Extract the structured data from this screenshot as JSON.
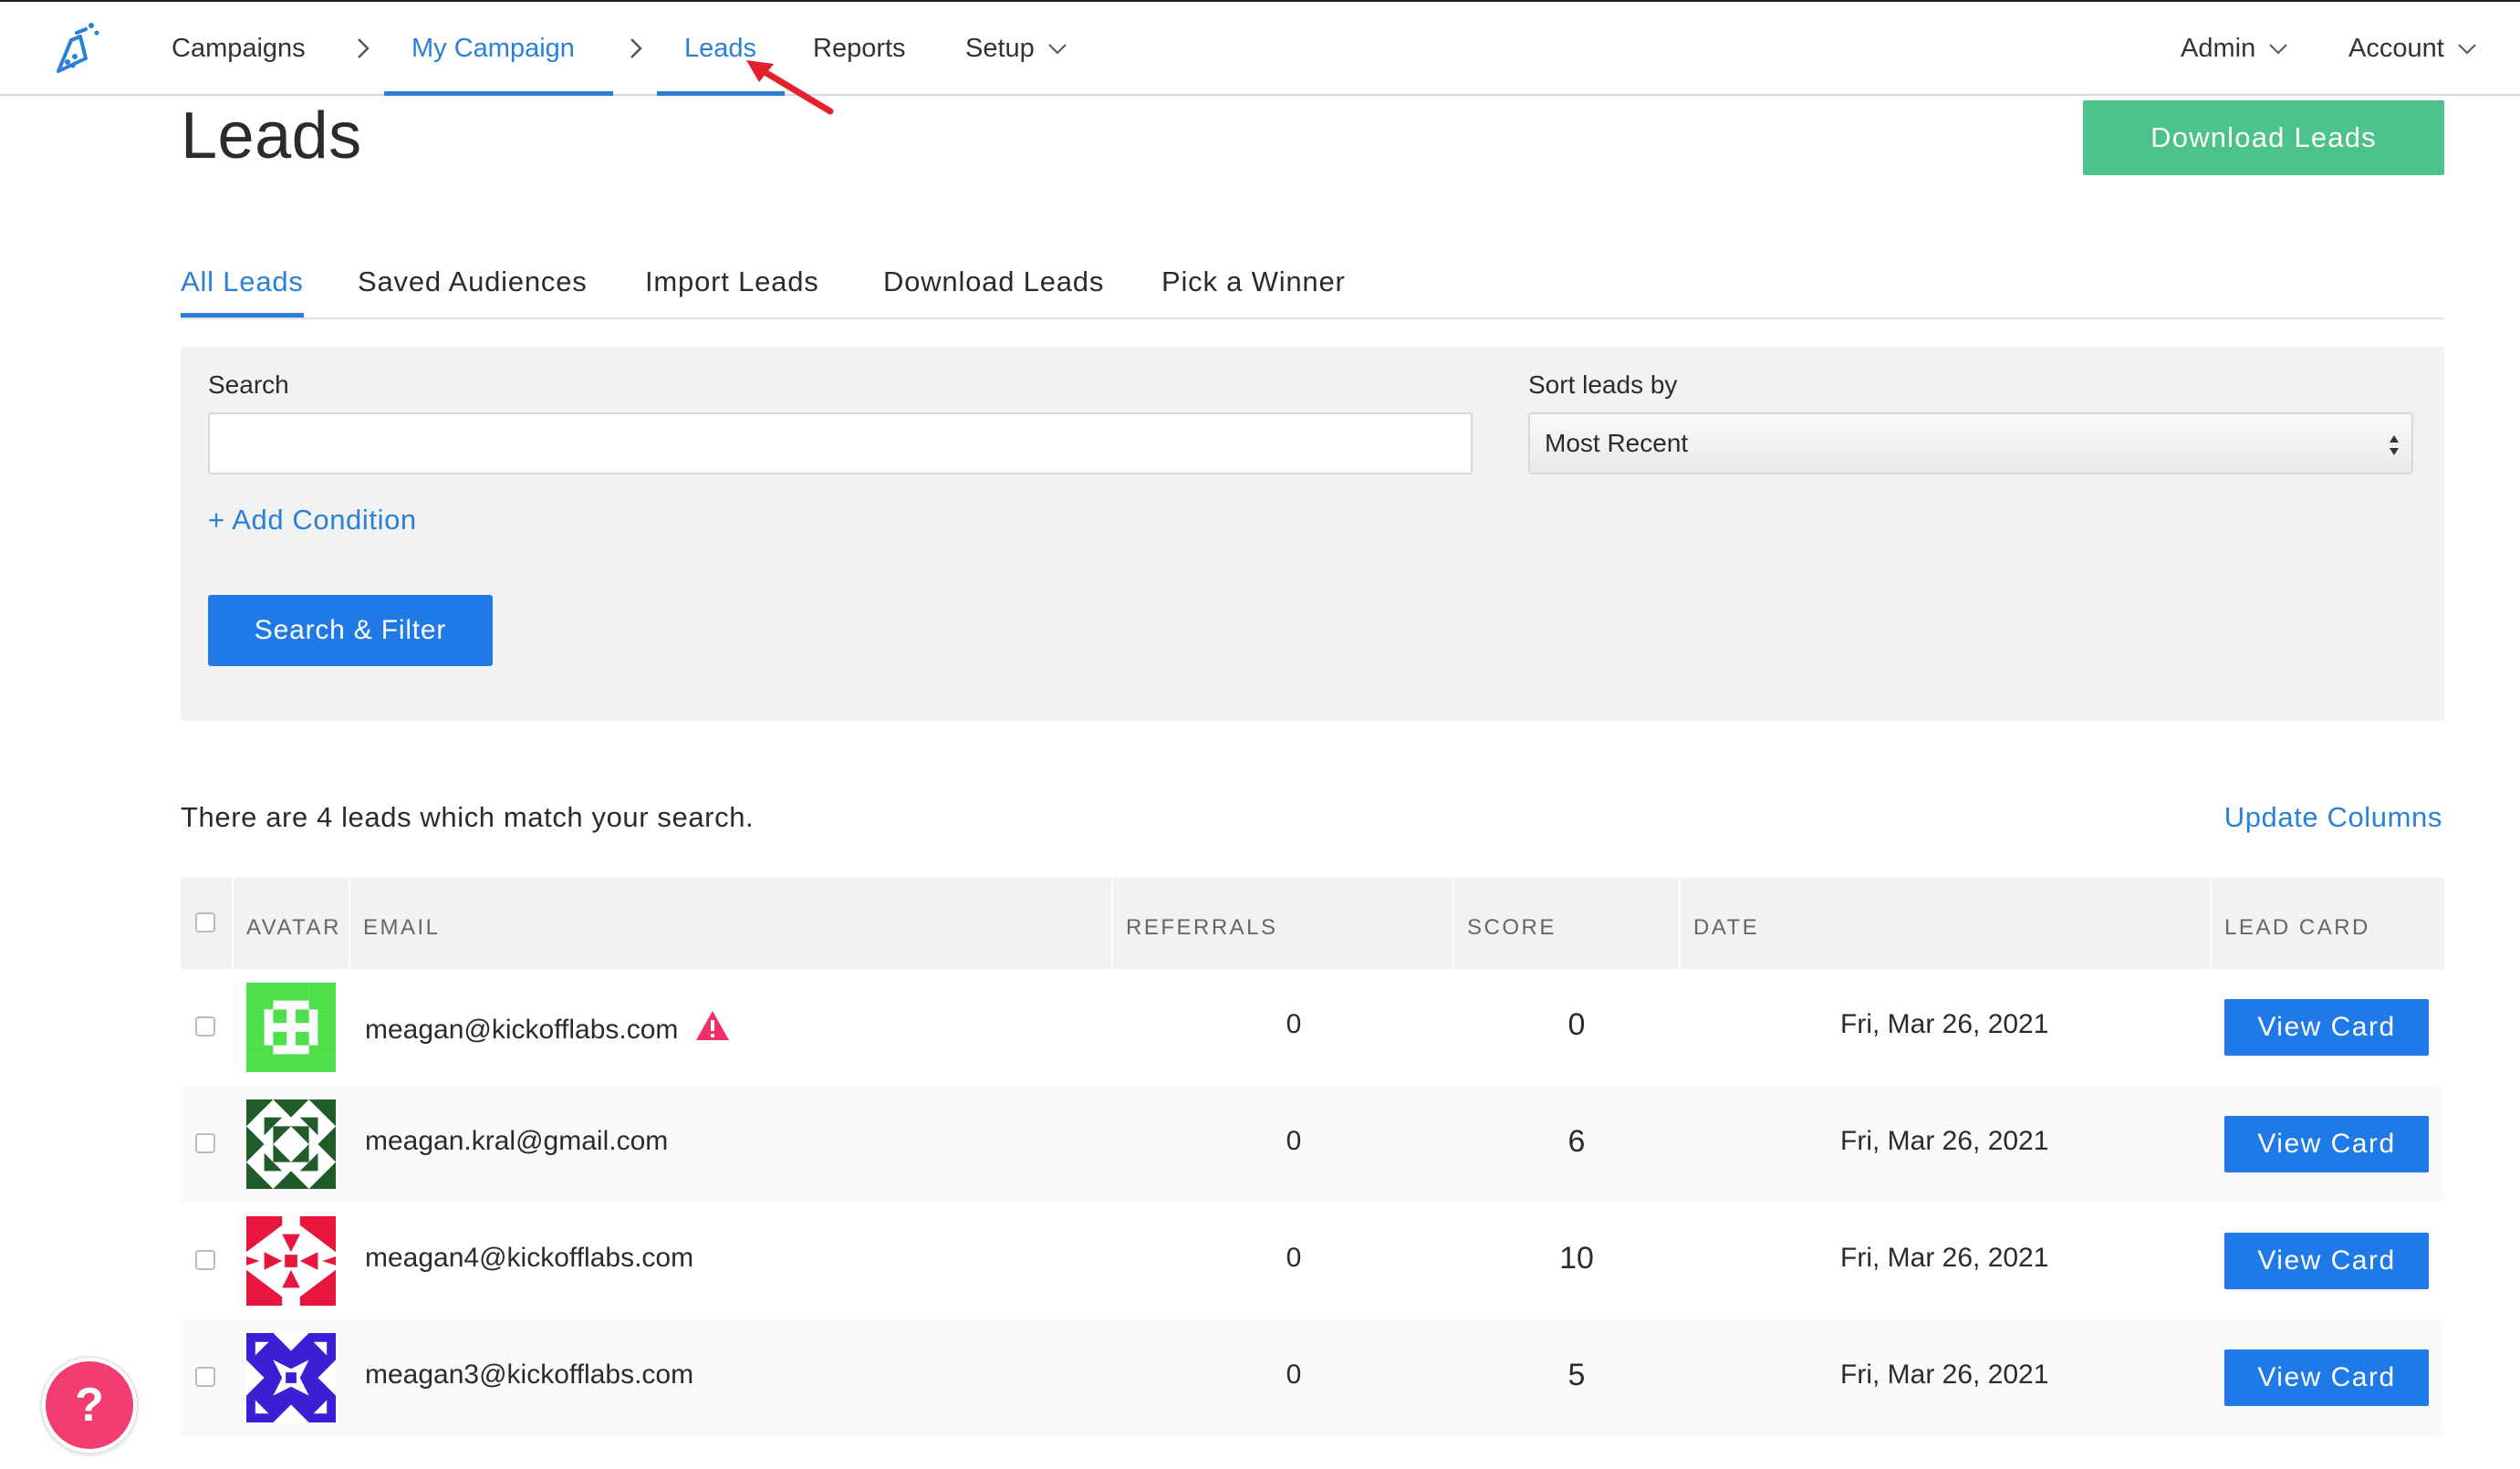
{
  "nav": {
    "breadcrumb": [
      "Campaigns",
      "My Campaign",
      "Leads"
    ],
    "reports": "Reports",
    "setup": "Setup",
    "admin": "Admin",
    "account": "Account"
  },
  "header": {
    "title": "Leads",
    "download_button": "Download Leads"
  },
  "tabs": [
    "All Leads",
    "Saved Audiences",
    "Import Leads",
    "Download Leads",
    "Pick a Winner"
  ],
  "filter": {
    "search_label": "Search",
    "search_value": "",
    "sort_label": "Sort leads by",
    "sort_value": "Most Recent",
    "add_condition": "+ Add Condition",
    "search_button": "Search & Filter"
  },
  "results": {
    "summary": "There are 4 leads which match your search.",
    "update_columns": "Update Columns"
  },
  "table": {
    "headers": [
      "AVATAR",
      "EMAIL",
      "REFERRALS",
      "SCORE",
      "DATE",
      "LEAD CARD"
    ],
    "rows": [
      {
        "email": "meagan@kickofflabs.com",
        "warning": true,
        "referrals": "0",
        "score": "0",
        "date": "Fri, Mar 26, 2021",
        "action": "View Card",
        "avatar_color": "#4ee04a"
      },
      {
        "email": "meagan.kral@gmail.com",
        "warning": false,
        "referrals": "0",
        "score": "6",
        "date": "Fri, Mar 26, 2021",
        "action": "View Card",
        "avatar_color": "#1f5c2a"
      },
      {
        "email": "meagan4@kickofflabs.com",
        "warning": false,
        "referrals": "0",
        "score": "10",
        "date": "Fri, Mar 26, 2021",
        "action": "View Card",
        "avatar_color": "#e8163c"
      },
      {
        "email": "meagan3@kickofflabs.com",
        "warning": false,
        "referrals": "0",
        "score": "5",
        "date": "Fri, Mar 26, 2021",
        "action": "View Card",
        "avatar_color": "#3b1fd4"
      }
    ]
  },
  "help": {
    "label": "?"
  },
  "colors": {
    "accent": "#2a7fd7",
    "primary_button": "#1f7ae8",
    "download_button": "#4cc38a",
    "help": "#f23d72",
    "warning": "#f0306a"
  }
}
